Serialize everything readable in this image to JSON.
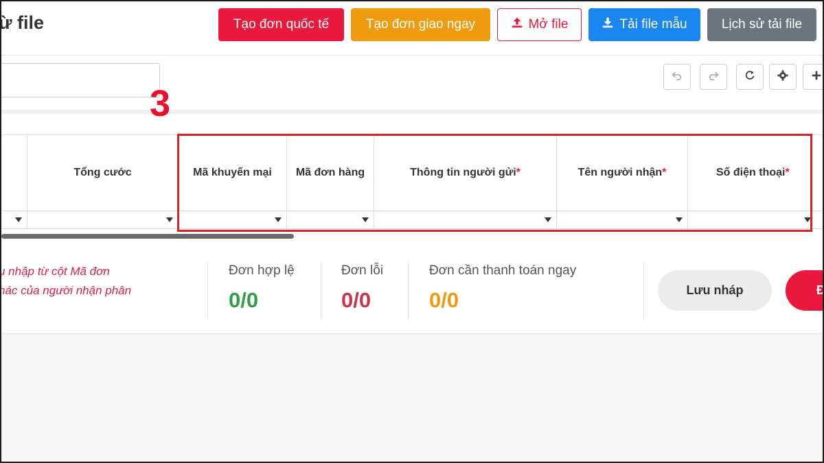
{
  "header": {
    "title": "ừ file",
    "buttons": {
      "intl": "Tạo đơn quốc tế",
      "ship_now": "Tạo đơn giao ngay",
      "open_file": "Mở file",
      "template": "Tải file mẫu",
      "history": "Lịch sử tải file"
    }
  },
  "toolbar": {
    "search_value": "",
    "icons": [
      "undo-icon",
      "redo-icon",
      "refresh-icon",
      "gear-icon",
      "plus-icon"
    ]
  },
  "annotation": {
    "step_number": "3"
  },
  "grid": {
    "columns": [
      {
        "label": "",
        "required": false
      },
      {
        "label": "Tổng cước",
        "required": false
      },
      {
        "label": "Mã khuyến mại",
        "required": false
      },
      {
        "label": "Mã đơn hàng",
        "required": false
      },
      {
        "label": "Thông tin người gửi",
        "required": true
      },
      {
        "label": "Tên người nhận",
        "required": true
      },
      {
        "label": "Số điện thoại",
        "required": true
      }
    ],
    "required_mark": "*"
  },
  "summary": {
    "note_line1": "u nhập từ cột Mã đơn",
    "note_line2": "hác của người nhận phân",
    "valid_label": "Đơn hợp lệ",
    "valid_value": "0/0",
    "error_label": "Đơn lỗi",
    "error_value": "0/0",
    "pay_label": "Đơn cần thanh toán ngay",
    "pay_value": "0/0",
    "draft_button": "Lưu nháp",
    "submit_button": "Đ"
  },
  "colors": {
    "primary_red": "#e8193c",
    "orange": "#ef9b0f",
    "blue": "#1a86f0",
    "gray": "#6c757d",
    "green": "#2f9e44",
    "highlight_red": "#e02020"
  }
}
